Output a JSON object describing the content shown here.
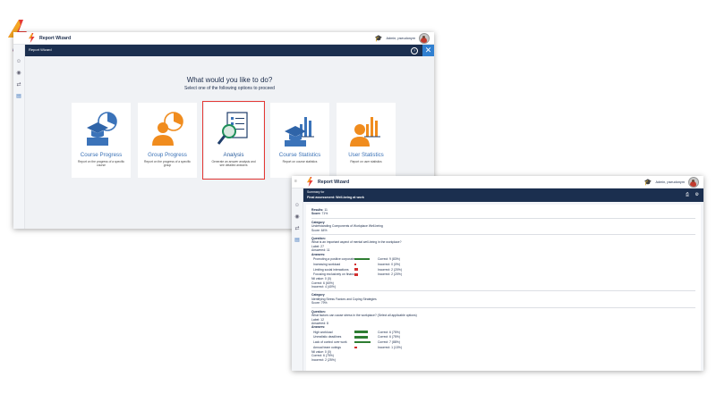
{
  "app": {
    "title": "Report Wizard",
    "user": "Admin, pseudonym"
  },
  "window1": {
    "nav_title": "Report Wizard",
    "heading": "What would you like to do?",
    "subheading": "Select one of the following options to proceed",
    "cards": [
      {
        "title": "Course Progress",
        "description": "Report on the progress of a specific course",
        "icon": "course-progress-icon"
      },
      {
        "title": "Group Progress",
        "description": "Report on the progress of a specific group",
        "icon": "group-progress-icon"
      },
      {
        "title": "Analysis",
        "description": "Generate an answer analysis and see detailed answers",
        "icon": "analysis-icon"
      },
      {
        "title": "Course Statistics",
        "description": "Report on course statistics",
        "icon": "course-statistics-icon"
      },
      {
        "title": "User Statistics",
        "description": "Report on user statistics",
        "icon": "user-statistics-icon"
      }
    ]
  },
  "window2": {
    "summary_label": "Summary for",
    "summary_title": "Final assessment: Well-being at work",
    "results_label": "Results:",
    "results_value": "11",
    "score_label": "Score:",
    "score_value": "71%",
    "category1": {
      "label": "Category",
      "name": "Understanding Components of Workplace Well-being",
      "score": "Score: 64%"
    },
    "question1": {
      "label": "Question:",
      "text": "What is an important aspect of mental well-being in the workplace?",
      "meta1": "Label: 27",
      "meta2": "Answered: 11",
      "answers_label": "Answers:",
      "answers": [
        {
          "text": "Promoting a positive corporate culture",
          "result": "Correct: 9 (83%)",
          "level": 0.83,
          "color": "green"
        },
        {
          "text": "Increasing workload",
          "result": "Incorrect: 0 (0%)",
          "level": 0,
          "color": "red"
        },
        {
          "text": "Limiting social interactions",
          "result": "Incorrect: 2 (20%)",
          "level": 0.2,
          "color": "red"
        },
        {
          "text": "Focusing exclusively on financial rewards",
          "result": "Incorrect: 2 (20%)",
          "level": 0.2,
          "color": "red"
        }
      ],
      "stats1": "Nil value: 0 (0)",
      "stats2": "Correct: 6 (60%)",
      "stats3": "Incorrect: 4 (40%)"
    },
    "category2": {
      "label": "Category",
      "name": "Identifying Stress Factors and Coping Strategies",
      "score": "Score: 79%"
    },
    "question2": {
      "label": "Question:",
      "text": "What factors can cause stress in the workplace? (Select all applicable options)",
      "meta1": "Label: 12",
      "meta2": "Answered: 8",
      "answers_label": "Answers:",
      "answers": [
        {
          "text": "High workload",
          "result": "Correct: 6 (75%)",
          "level": 0.75,
          "color": "green"
        },
        {
          "text": "Unrealistic deadlines",
          "result": "Correct: 6 (75%)",
          "level": 0.75,
          "color": "green"
        },
        {
          "text": "Lack of control over work",
          "result": "Correct: 7 (88%)",
          "level": 0.88,
          "color": "green"
        },
        {
          "text": "Annual team outings",
          "result": "Incorrect: 1 (13%)",
          "level": 0.13,
          "color": "red"
        }
      ],
      "stats1": "Nil value: 0 (0)",
      "stats2": "Correct: 6 (75%)",
      "stats3": "Incorrect: 2 (25%)"
    }
  }
}
